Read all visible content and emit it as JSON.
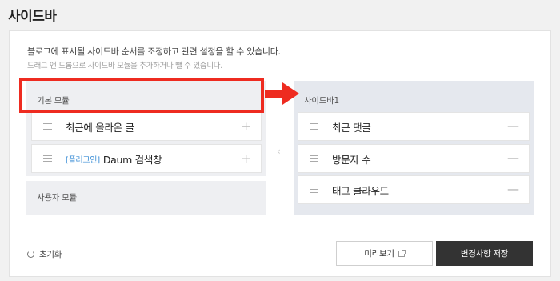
{
  "page": {
    "title": "사이드바",
    "description": "블로그에 표시될 사이드바 순서를 조정하고 관련 설정을 할 수 있습니다.",
    "hint": "드래그 앤 드롭으로 사이드바 모듈을 추가하거나 뺄 수 있습니다."
  },
  "left_panel": {
    "basic_header": "기본 모듈",
    "basic_modules": [
      {
        "label": "최근에 올라온 글",
        "tag": "",
        "action": "+"
      },
      {
        "label": "Daum 검색창",
        "tag": "[플러그인]",
        "action": "+"
      }
    ],
    "user_header": "사용자 모듈"
  },
  "right_panel": {
    "header": "사이드바1",
    "modules": [
      {
        "label": "최근 댓글",
        "action": "—"
      },
      {
        "label": "방문자 수",
        "action": "—"
      },
      {
        "label": "태그 클라우드",
        "action": "—"
      }
    ]
  },
  "move_arrow_glyph": "‹",
  "footer": {
    "reset_label": "초기화",
    "preview_label": "미리보기",
    "save_label": "변경사항 저장"
  },
  "colors": {
    "highlight": "#ee2b20",
    "plugin_tag": "#3b8ed6",
    "save_button": "#333333"
  }
}
